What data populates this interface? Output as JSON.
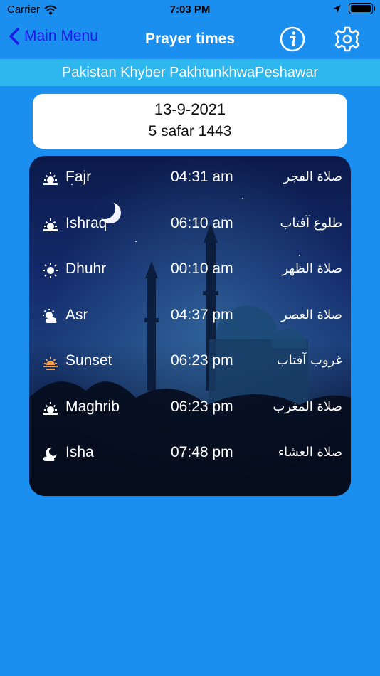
{
  "status_bar": {
    "carrier": "Carrier",
    "time": "7:03 PM"
  },
  "nav": {
    "back_label": "Main Menu",
    "title": "Prayer times"
  },
  "location": "Pakistan Khyber PakhtunkhwaPeshawar",
  "date": {
    "gregorian": "13-9-2021",
    "hijri": "5 safar 1443"
  },
  "prayers": [
    {
      "name": "Fajr",
      "time": "04:31 am",
      "arabic": "صلاة الفجر",
      "icon": "sunrise-icon"
    },
    {
      "name": "Ishraq",
      "time": "06:10 am",
      "arabic": "طلوع آفتاب",
      "icon": "sunrise-icon"
    },
    {
      "name": "Dhuhr",
      "time": "00:10 am",
      "arabic": "صلاة الظهر",
      "icon": "sun-icon"
    },
    {
      "name": "Asr",
      "time": "04:37 pm",
      "arabic": "صلاة العصر",
      "icon": "sun-cloud-icon"
    },
    {
      "name": "Sunset",
      "time": "06:23 pm",
      "arabic": "غروب آفتاب",
      "icon": "sunset-icon"
    },
    {
      "name": "Maghrib",
      "time": "06:23 pm",
      "arabic": "صلاة المغرب",
      "icon": "sunrise-icon"
    },
    {
      "name": "Isha",
      "time": "07:48 pm",
      "arabic": "صلاة العشاء",
      "icon": "moon-cloud-icon"
    }
  ],
  "colors": {
    "background": "#1b8ff0",
    "location_bar": "#2eb6ee",
    "back_link": "#1a1ae6",
    "sunset_icon": "#f4a24a"
  }
}
